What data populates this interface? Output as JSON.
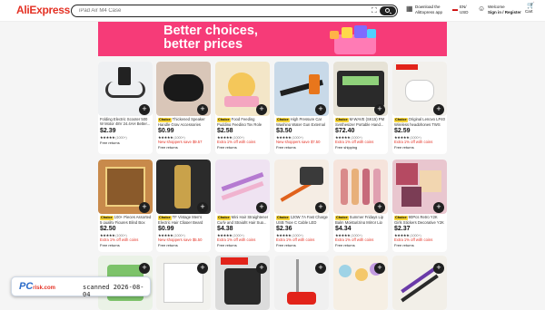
{
  "header": {
    "logo": "AliExpress",
    "search_placeholder": "iPad Air M4 Case",
    "app_line1": "Download the",
    "app_line2": "AliExpress app",
    "region_line1": "EN/",
    "region_line2": "USD",
    "welcome_line1": "Welcome",
    "welcome_line2": "Sign in / Register",
    "cart_count": "0",
    "cart_label": "Cart"
  },
  "banner": {
    "line1": "Better choices,",
    "line2": "better prices",
    "bg_color": "#f63b78"
  },
  "products": [
    {
      "title": "Folding Electric Scooter 500 W Motor 48V 24.4AH Better...",
      "choice": false,
      "price": "$2.39",
      "sold": "(1000+)",
      "promo": "",
      "returns": "Free returns"
    },
    {
      "title": "Thickened Speaker Handle Gray Accessories Univer...",
      "choice": true,
      "price": "$0.99",
      "sold": "(1000+)",
      "promo": "New shoppers save $9.57",
      "returns": "Free returns"
    },
    {
      "title": "Food Feeding Pudding Feeding Toy Role Play Early...",
      "choice": true,
      "price": "$2.58",
      "sold": "(1000+)",
      "promo": "Extra 1% off with coins",
      "returns": "Free returns"
    },
    {
      "title": "High Pressure Car Washing Water Gun External Cl...",
      "choice": true,
      "price": "$3.50",
      "sold": "(1000+)",
      "promo": "New shoppers save $7.50",
      "returns": "Free returns"
    },
    {
      "title": "M-WAVE (SK15) PM Synthesizer Portable Hand...",
      "choice": true,
      "price": "$72.40",
      "sold": "(1000+)",
      "promo": "Extra 1% off with coins",
      "returns": "Free shipping"
    },
    {
      "title": "Original Lenovo LP40 Wireless headphones TWS B...",
      "choice": true,
      "price": "$2.59",
      "sold": "(1000+)",
      "promo": "Extra 1% off with coins",
      "returns": "Free returns"
    },
    {
      "title": "100+ Pieces Assorted 5 quality Figures Blind Box Sur...",
      "choice": true,
      "price": "$2.50",
      "sold": "(1000+)",
      "promo": "Extra 1% off with coins",
      "returns": "Free returns"
    },
    {
      "title": "TF Vintage Men's Electric Hair Clipper Beard Trimmi...",
      "choice": true,
      "price": "$0.99",
      "sold": "(1000+)",
      "promo": "New shoppers save $5.50",
      "returns": "Free returns"
    },
    {
      "title": "Mini Hair Straightener Curly and Straight Hair Sup...",
      "choice": true,
      "price": "$4.38",
      "sold": "(1000+)",
      "promo": "Extra 1% off with coins",
      "returns": "Free returns"
    },
    {
      "title": "120W 7A Fast Charge USB Type C Cable LED Disp...",
      "choice": true,
      "price": "$2.36",
      "sold": "(1000+)",
      "promo": "Extra 1% off with coins",
      "returns": "Free returns"
    },
    {
      "title": "Summer Fridays Lip Balm Moisturizing Mirror Lip Gl...",
      "choice": true,
      "price": "$4.34",
      "sold": "(1000+)",
      "promo": "Extra 1% off with coins",
      "returns": "Free returns"
    },
    {
      "title": "90Pcs Retro Y2K Girls Stickers Decorative Y2K DIY...",
      "choice": true,
      "price": "$2.37",
      "sold": "(1000+)",
      "promo": "Extra 1% off with coins",
      "returns": "Free returns"
    }
  ],
  "watermark": {
    "logo": "PC",
    "logo_sub": "risk.com",
    "scan_text": "scanned 2026-08-04"
  }
}
